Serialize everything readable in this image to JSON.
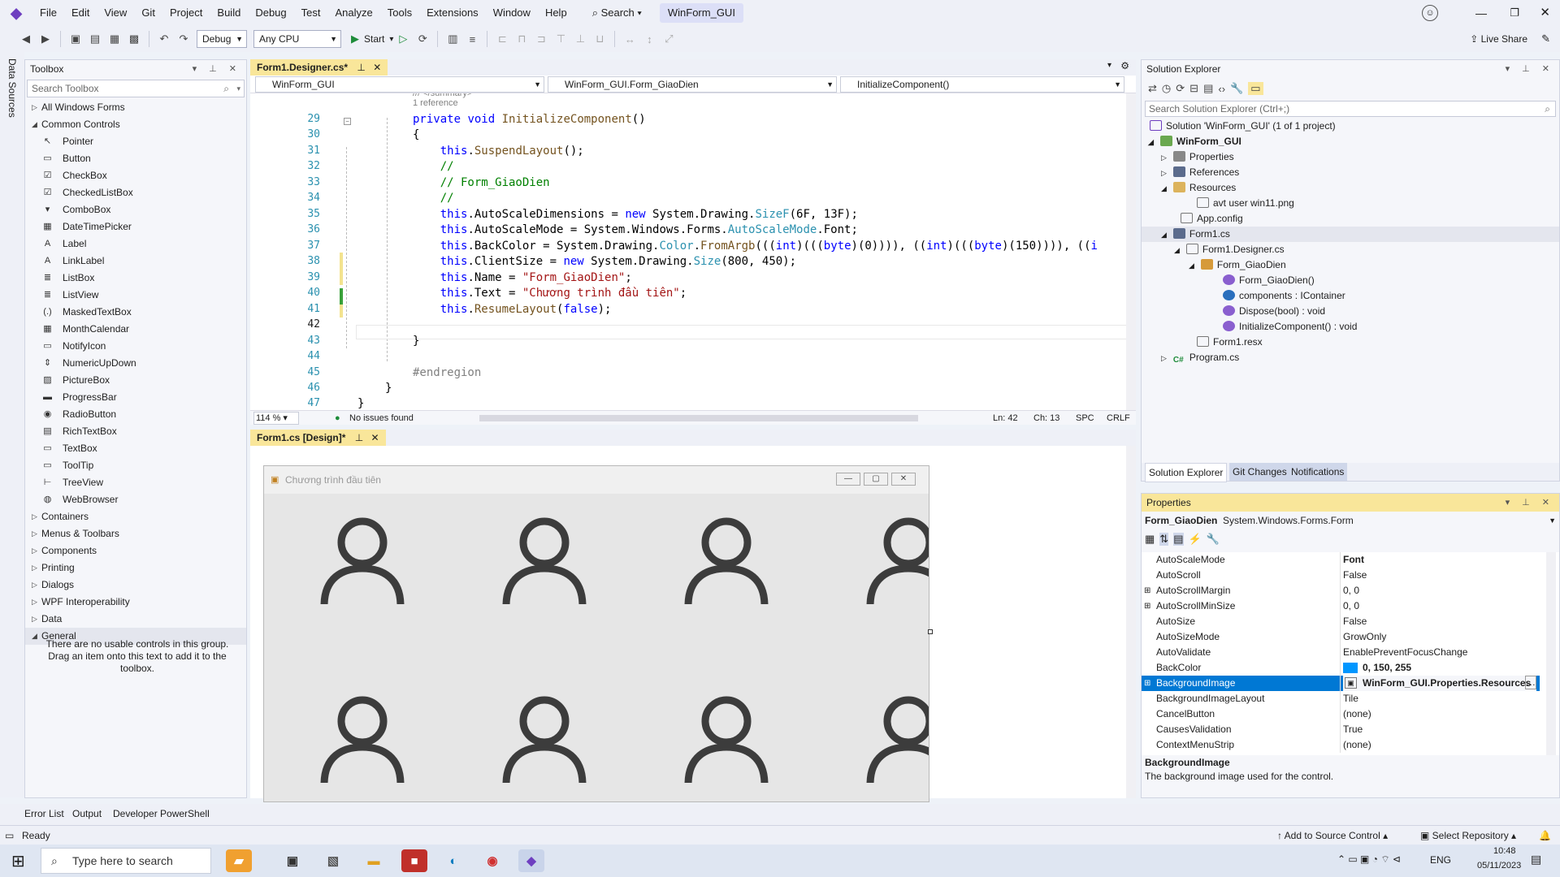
{
  "menu": [
    "File",
    "Edit",
    "View",
    "Git",
    "Project",
    "Build",
    "Debug",
    "Test",
    "Analyze",
    "Tools",
    "Extensions",
    "Window",
    "Help"
  ],
  "search_label": "Search",
  "solution_name": "WinForm_GUI",
  "toolbar": {
    "config": "Debug",
    "platform": "Any CPU",
    "start": "Start",
    "live_share": "Live Share"
  },
  "data_sources": "Data Sources",
  "toolbox": {
    "title": "Toolbox",
    "search_placeholder": "Search Toolbox",
    "groups_top": [
      "All Windows Forms",
      "Common Controls"
    ],
    "items": [
      "Pointer",
      "Button",
      "CheckBox",
      "CheckedListBox",
      "ComboBox",
      "DateTimePicker",
      "Label",
      "LinkLabel",
      "ListBox",
      "ListView",
      "MaskedTextBox",
      "MonthCalendar",
      "NotifyIcon",
      "NumericUpDown",
      "PictureBox",
      "ProgressBar",
      "RadioButton",
      "RichTextBox",
      "TextBox",
      "ToolTip",
      "TreeView",
      "WebBrowser"
    ],
    "groups_bottom": [
      "Containers",
      "Menus & Toolbars",
      "Components",
      "Printing",
      "Dialogs",
      "WPF Interoperability",
      "Data",
      "General"
    ],
    "general_msg": "There are no usable controls in this group. Drag an item onto this text to add it to the toolbox."
  },
  "editor": {
    "tab": "Form1.Designer.cs*",
    "nav1": "WinForm_GUI",
    "nav2": "WinForm_GUI.Form_GiaoDien",
    "nav3": "InitializeComponent()",
    "ref_hint": "1 reference",
    "zoom": "114 %",
    "issues": "No issues found",
    "ln": "Ln: 42",
    "ch": "Ch: 13",
    "spc": "SPC",
    "crlf": "CRLF"
  },
  "designer": {
    "tab": "Form1.cs [Design]*",
    "form_title": "Chương trình đầu tiên"
  },
  "solution_explorer": {
    "title": "Solution Explorer",
    "search_placeholder": "Search Solution Explorer (Ctrl+;)",
    "solution": "Solution 'WinForm_GUI' (1 of 1 project)",
    "project": "WinForm_GUI",
    "properties": "Properties",
    "references": "References",
    "resources": "Resources",
    "resource_file": "avt user win11.png",
    "app_config": "App.config",
    "form1": "Form1.cs",
    "designer_file": "Form1.Designer.cs",
    "class": "Form_GiaoDien",
    "members": [
      "Form_GiaoDien()",
      "components : IContainer",
      "Dispose(bool) : void",
      "InitializeComponent() : void"
    ],
    "resx": "Form1.resx",
    "program": "Program.cs",
    "tabs": [
      "Solution Explorer",
      "Git Changes",
      "Notifications"
    ]
  },
  "properties": {
    "title": "Properties",
    "object": "Form_GiaoDien",
    "object_type": "System.Windows.Forms.Form",
    "rows": [
      {
        "name": "AutoScaleMode",
        "value": "Font"
      },
      {
        "name": "AutoScroll",
        "value": "False"
      },
      {
        "name": "AutoScrollMargin",
        "value": "0, 0"
      },
      {
        "name": "AutoScrollMinSize",
        "value": "0, 0"
      },
      {
        "name": "AutoSize",
        "value": "False"
      },
      {
        "name": "AutoSizeMode",
        "value": "GrowOnly"
      },
      {
        "name": "AutoValidate",
        "value": "EnablePreventFocusChange"
      },
      {
        "name": "BackColor",
        "value": "0, 150, 255"
      },
      {
        "name": "BackgroundImage",
        "value": "WinForm_GUI.Properties.Resources"
      },
      {
        "name": "BackgroundImageLayout",
        "value": "Tile"
      },
      {
        "name": "CancelButton",
        "value": "(none)"
      },
      {
        "name": "CausesValidation",
        "value": "True"
      },
      {
        "name": "ContextMenuStrip",
        "value": "(none)"
      }
    ],
    "desc_title": "BackgroundImage",
    "desc_text": "The background image used for the control."
  },
  "bottom_tabs": [
    "Error List",
    "Output",
    "Developer PowerShell"
  ],
  "status": {
    "ready": "Ready",
    "source_control": "Add to Source Control",
    "repo": "Select Repository"
  },
  "taskbar": {
    "search_placeholder": "Type here to search",
    "lang": "ENG",
    "time": "10:48",
    "date": "05/11/2023"
  },
  "colors": {
    "accent": "#0078d4",
    "backcolor_swatch": "#0096ff",
    "vs_purple": "#6e3fc0"
  }
}
